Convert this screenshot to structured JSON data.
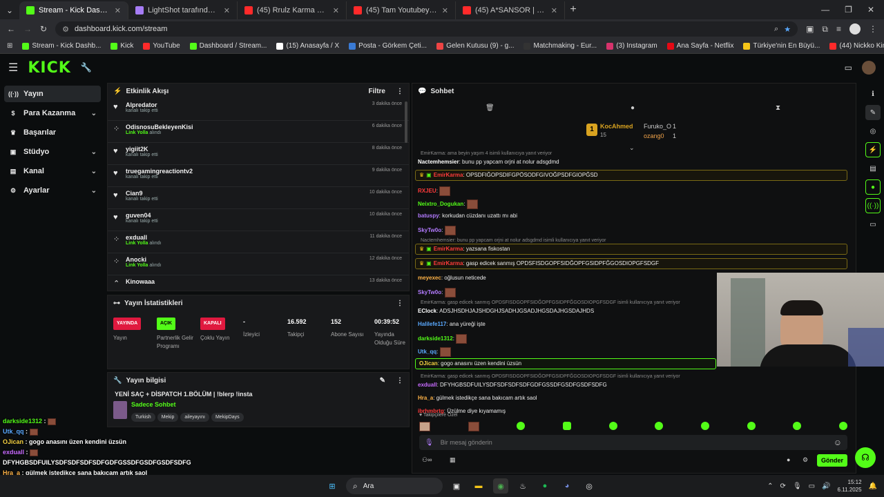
{
  "browser": {
    "tabs": [
      {
        "title": "Stream - Kick Dashboard",
        "color": "#53fc18",
        "active": true
      },
      {
        "title": "LightShot tarafından Ekran Gör",
        "color": "#a67cf6",
        "active": false
      },
      {
        "title": "(45) Rrulz Karma Karışık #14 - Y",
        "color": "#ff2a2a",
        "active": false
      },
      {
        "title": "(45) Tam Youtubeyi Kapatıcakke",
        "color": "#ff2a2a",
        "active": false
      },
      {
        "title": "(45) A*SANSOR | Madara Olduk",
        "color": "#ff2a2a",
        "active": false
      }
    ],
    "url": "dashboard.kick.com/stream",
    "bookmarks": [
      {
        "label": "Stream - Kick Dashb...",
        "color": "#53fc18"
      },
      {
        "label": "Kick",
        "color": "#53fc18"
      },
      {
        "label": "YouTube",
        "color": "#ff2a2a"
      },
      {
        "label": "Dashboard / Stream...",
        "color": "#53fc18"
      },
      {
        "label": "(15) Anasayfa / X",
        "color": "#ffffff"
      },
      {
        "label": "Posta - Görkem Çeti...",
        "color": "#3a7bd5"
      },
      {
        "label": "Gelen Kutusu (9) - g...",
        "color": "#e44"
      },
      {
        "label": "Matchmaking - Eur...",
        "color": "#333"
      },
      {
        "label": "(3) Instagram",
        "color": "#d6336c"
      },
      {
        "label": "Ana Sayfa - Netflix",
        "color": "#e50914"
      },
      {
        "label": "Türkiye'nin En Büyü...",
        "color": "#f5c518"
      },
      {
        "label": "(44) Nickko Kimiko...",
        "color": "#ff2a2a"
      }
    ]
  },
  "app": {
    "logo": "KICK"
  },
  "sidebar": {
    "items": [
      {
        "label": "Yayın",
        "icon": "broadcast-icon",
        "active": true,
        "chev": false
      },
      {
        "label": "Para Kazanma",
        "icon": "money-icon",
        "active": false,
        "chev": true
      },
      {
        "label": "Başarılar",
        "icon": "trophy-icon",
        "active": false,
        "chev": false
      },
      {
        "label": "Stüdyo",
        "icon": "studio-icon",
        "active": false,
        "chev": true
      },
      {
        "label": "Kanal",
        "icon": "channel-icon",
        "active": false,
        "chev": true
      },
      {
        "label": "Ayarlar",
        "icon": "gear-icon",
        "active": false,
        "chev": true
      }
    ]
  },
  "activity": {
    "title": "Etkinlik Akışı",
    "filter": "Filtre",
    "items": [
      {
        "name": "Alpredator",
        "pre": "kanalı takip etti",
        "green": "",
        "post": "",
        "time": "3 dakika önce",
        "type": "follow"
      },
      {
        "name": "OdisnosuBekleyenKisi",
        "pre": "",
        "green": "Link Yolla",
        "post": " alındı",
        "time": "6 dakika önce",
        "type": "reward"
      },
      {
        "name": "yigiit2K",
        "pre": "kanalı takip etti",
        "green": "",
        "post": "",
        "time": "8 dakika önce",
        "type": "follow"
      },
      {
        "name": "truegamingreactiontv2",
        "pre": "kanalı takip etti",
        "green": "",
        "post": "",
        "time": "9 dakika önce",
        "type": "follow"
      },
      {
        "name": "Cian9",
        "pre": "kanalı takip etti",
        "green": "",
        "post": "",
        "time": "10 dakika önce",
        "type": "follow"
      },
      {
        "name": "guven04",
        "pre": "kanalı takip etti",
        "green": "",
        "post": "",
        "time": "10 dakika önce",
        "type": "follow"
      },
      {
        "name": "exduall",
        "pre": "",
        "green": "Link Yolla",
        "post": " alındı",
        "time": "11 dakika önce",
        "type": "reward"
      },
      {
        "name": "Anocki",
        "pre": "",
        "green": "Link Yolla",
        "post": " alındı",
        "time": "12 dakika önce",
        "type": "reward"
      },
      {
        "name": "Kinowaaa",
        "pre": "",
        "green": "",
        "post": "",
        "time": "13 dakika önce",
        "type": "host"
      }
    ]
  },
  "stats": {
    "title": "Yayın İstatistikleri",
    "yayin_badge": "YAYINDA",
    "yayin_label": "Yayın",
    "partner_badge": "AÇIK",
    "partner_label": "Partnerlik Gelir Programı",
    "coklu_badge": "KAPALI",
    "coklu_label": "Çoklu Yayın",
    "viewers_value": "-",
    "viewers_label": "İzleyici",
    "followers_value": "16.592",
    "followers_label": "Takipçi",
    "subs_value": "152",
    "subs_label": "Abone Sayısı",
    "uptime_value": "00:39:52",
    "uptime_label": "Yayında Olduğu Süre"
  },
  "info": {
    "title": "Yayın bilgisi",
    "stream_title": "YENİ SAÇ + DİSPATCH 1.BÖLÜM | !blerp !insta",
    "category": "Sadece Sohbet",
    "tags": [
      "Turkish",
      "Mekip",
      "aileyayını",
      "MekipDays"
    ]
  },
  "chat": {
    "title": "Sohbet",
    "top1_name": "KocAhmed",
    "top1_count": "15",
    "top2_name": "Furuko_O",
    "top2_count": "1",
    "top3_name": "ozang0",
    "top3_count": "1",
    "followers_only": "Takipçilere Özel",
    "placeholder": "Bir mesaj gönderin",
    "send": "Gönder",
    "messages": [
      {
        "reply": "EmirKarma: ama beyin yaşım 4 isimli kullanıcıya yanıt veriyor",
        "user": "Nactemhemsier",
        "color": "#ffffff",
        "text": "bunu pp yapcam orjni at nolur adsgdmd",
        "hl": false,
        "emote": false
      },
      {
        "reply": "",
        "user": "EmirKarma",
        "color": "#ff3b3b",
        "text": "OPSDFIĞOPSDIFGPÖSODFGIVOĞPSDFGIOPĞSD",
        "hl": true,
        "emote": false
      },
      {
        "reply": "",
        "user": "RXJEU",
        "color": "#ff3b3b",
        "text": "",
        "hl": false,
        "emote": true
      },
      {
        "reply": "",
        "user": "Neixtro_Dogukan",
        "color": "#53fc18",
        "text": "",
        "hl": false,
        "emote": true
      },
      {
        "reply": "",
        "user": "batuspy",
        "color": "#b37bff",
        "text": "korkudan cüzdanı uzattı mı abi",
        "hl": false,
        "emote": false
      },
      {
        "reply": "",
        "user": "SkyTw0o",
        "color": "#b37bff",
        "text": "",
        "hl": false,
        "emote": true
      },
      {
        "reply": "Nactemhemsier: bunu pp yapcam orjni at nolur adsgdmd  isimli kullanıcıya yanıt veriyor",
        "user": "EmirKarma",
        "color": "#ff3b3b",
        "text": "yazsana fiskostan",
        "hl": true,
        "emote": false
      },
      {
        "reply": "",
        "user": "EmirKarma",
        "color": "#ff3b3b",
        "text": "gasp edicek sanmış OPDSFISDGOPFSIDĞOPFGSIDPFĞGOSDIOPGFSDGF",
        "hl": true,
        "emote": false
      },
      {
        "reply": "",
        "user": "meyexec",
        "color": "#ffb347",
        "text": "oğlusun neticede",
        "hl": false,
        "emote": false
      },
      {
        "reply": "",
        "user": "SkyTw0o",
        "color": "#b37bff",
        "text": "",
        "hl": false,
        "emote": true
      },
      {
        "reply": "EmirKarma: gasp edicek sanmış OPDSFISDGOPFSIDĞOPFGSIDPFĞGOSDIOPGFSDGF isimli kullanıcıya yanıt veriyor",
        "user": "EClock",
        "color": "#ffffff",
        "text": "ADSJHSDHJAJSHDGHJSADHJGSADJHGSDAJHGSDAJHDS",
        "hl": false,
        "emote": false
      },
      {
        "reply": "",
        "user": "Halilefe117",
        "color": "#5aa9ff",
        "text": "ana yüreği işte",
        "hl": false,
        "emote": false
      },
      {
        "reply": "",
        "user": "darkside1312",
        "color": "#53fc18",
        "text": "",
        "hl": false,
        "emote": true
      },
      {
        "reply": "",
        "user": "Utk_qq",
        "color": "#5aa9ff",
        "text": "",
        "hl": false,
        "emote": true
      },
      {
        "reply": "",
        "user": "OJican",
        "color": "#f5d142",
        "text": "gogo anasını üzen kendini üzsün",
        "hl": true,
        "emote": false
      },
      {
        "reply": "EmirKarma: gasp edicek sanmış OPDSFISDGOPFSIDĞOPFGSIDPFĞGOSDIOPGFSDGF isimli kullanıcıya yanıt veriyor",
        "user": "exduall",
        "color": "#c86bff",
        "text": "DFYHGBSDFUILYSDFSDFSDFSDFGDFGSSDFGSDFGSDFSDFG",
        "hl": false,
        "emote": false
      },
      {
        "reply": "",
        "user": "Hra_a",
        "color": "#ffb347",
        "text": "gülmek istedikçe sana bakıcam artık saol",
        "hl": false,
        "emote": false
      },
      {
        "reply": "",
        "user": "ibrhmbrtg",
        "color": "#ff3b3b",
        "text": "Üzülme diye kıyamamış",
        "hl": false,
        "emote": false
      }
    ]
  },
  "overlay": {
    "lines": [
      {
        "user": "darkside1312",
        "color": "#53fc18",
        "text": ""
      },
      {
        "user": "Utk_qq",
        "color": "#5aa9ff",
        "text": ""
      },
      {
        "user": "OJican",
        "color": "#f5d142",
        "text": "gogo anasını üzen kendini üzsün"
      },
      {
        "user": "exduall",
        "color": "#c86bff",
        "text": ""
      },
      {
        "user": "",
        "color": "#ffffff",
        "text": "DFYHGBSDFUILYSDFSDFSDFSDFGDFGSSDFGSDFGSDFSDFG"
      },
      {
        "user": "Hra_a",
        "color": "#ffb347",
        "text": "gülmek istedikçe sana bakıcam artık saol"
      },
      {
        "user": "ibrhmbrtg",
        "color": "#ff3b3b",
        "text": "Üzülme diye kıyamamış"
      }
    ]
  },
  "taskbar": {
    "search": "Ara",
    "time": "15:12",
    "date": "6.11.2025"
  }
}
